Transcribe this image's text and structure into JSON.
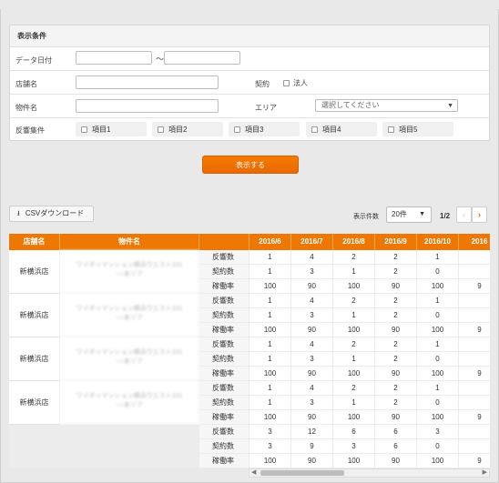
{
  "panel": {
    "title": "表示条件",
    "data_date_label": "データ日付",
    "tilde": "～",
    "shop_name_label": "店舗名",
    "contract_label": "契約",
    "corporate_label": "法人",
    "property_label": "物件名",
    "area_label": "エリア",
    "area_placeholder": "選択してください",
    "response_condition_label": "反響集件",
    "items": [
      "項目1",
      "項目2",
      "項目3",
      "項目4",
      "項目5"
    ]
  },
  "show_button": "表示する",
  "csv_button": "CSVダウンロード",
  "count_label": "表示件数",
  "count_value": "20件",
  "pager": "1/2",
  "table": {
    "headers": {
      "shop": "店舗名",
      "property": "物件名",
      "months": [
        "2016/6",
        "2016/7",
        "2016/8",
        "2016/9",
        "2016/10",
        "2016"
      ]
    },
    "metrics": [
      "反響数",
      "契約数",
      "稼働率"
    ],
    "groups": [
      {
        "shop": "新横浜店",
        "property_line1": "ワイポッマンション横浜ウエスト101",
        "property_line2": "○○あリア",
        "rows": [
          [
            "1",
            "4",
            "2",
            "2",
            "1",
            ""
          ],
          [
            "1",
            "3",
            "1",
            "2",
            "0",
            ""
          ],
          [
            "100",
            "90",
            "100",
            "90",
            "100",
            "9"
          ]
        ]
      },
      {
        "shop": "新横浜店",
        "property_line1": "ワイポッマンション横浜ウエスト101",
        "property_line2": "○○あリア",
        "rows": [
          [
            "1",
            "4",
            "2",
            "2",
            "1",
            ""
          ],
          [
            "1",
            "3",
            "1",
            "2",
            "0",
            ""
          ],
          [
            "100",
            "90",
            "100",
            "90",
            "100",
            "9"
          ]
        ]
      },
      {
        "shop": "新横浜店",
        "property_line1": "ワイポッマンション横浜ウエスト101",
        "property_line2": "○○あリア",
        "rows": [
          [
            "1",
            "4",
            "2",
            "2",
            "1",
            ""
          ],
          [
            "1",
            "3",
            "1",
            "2",
            "0",
            ""
          ],
          [
            "100",
            "90",
            "100",
            "90",
            "100",
            "9"
          ]
        ]
      },
      {
        "shop": "新横浜店",
        "property_line1": "ワイポッマンション横浜ウエスト101",
        "property_line2": "○○あリア",
        "rows": [
          [
            "1",
            "4",
            "2",
            "2",
            "1",
            ""
          ],
          [
            "1",
            "3",
            "1",
            "2",
            "0",
            ""
          ],
          [
            "100",
            "90",
            "100",
            "90",
            "100",
            "9"
          ]
        ]
      }
    ],
    "totals": [
      [
        "3",
        "12",
        "6",
        "6",
        "3",
        ""
      ],
      [
        "3",
        "9",
        "3",
        "6",
        "0",
        ""
      ],
      [
        "100",
        "90",
        "100",
        "90",
        "100",
        "9"
      ]
    ]
  },
  "colors": {
    "accent": "#ee7700"
  },
  "icons": {
    "download": "download-icon",
    "chevron": "chevron-down-icon"
  }
}
